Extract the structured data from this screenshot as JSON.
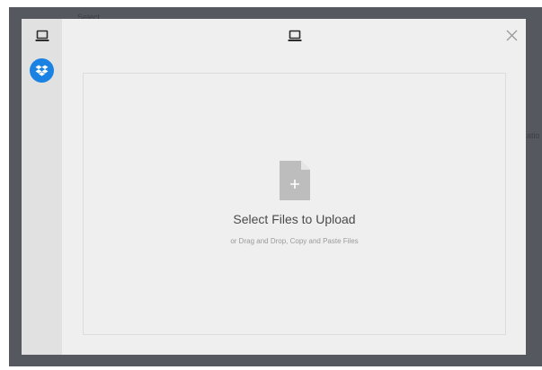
{
  "background": {
    "fragment_left": "Select",
    "fragment_right": "atio"
  },
  "sidebar": {
    "items": [
      {
        "icon": "laptop-icon"
      },
      {
        "icon": "dropbox-icon",
        "color": "#1a82e2"
      }
    ]
  },
  "header": {
    "source_icon": "laptop-icon",
    "close_icon": "close-icon"
  },
  "dropzone": {
    "icon": "file-plus-icon",
    "title": "Select Files to Upload",
    "subtitle": "or Drag and Drop, Copy and Paste Files"
  },
  "colors": {
    "accent": "#1a82e2",
    "modal_bg": "#efefef",
    "sidebar_bg": "#e1e1e1",
    "backdrop": "#55585f"
  }
}
